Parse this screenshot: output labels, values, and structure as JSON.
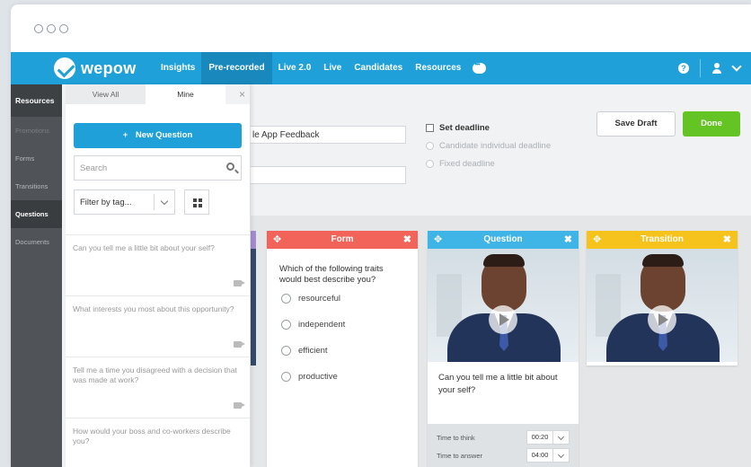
{
  "navbar": {
    "brand": "wepow",
    "items": [
      {
        "label": "Insights",
        "active": false
      },
      {
        "label": "Pre-recorded",
        "active": true
      },
      {
        "label": "Live 2.0",
        "active": false
      },
      {
        "label": "Live",
        "active": false
      },
      {
        "label": "Candidates",
        "active": false
      },
      {
        "label": "Resources",
        "active": false
      }
    ],
    "help": "?"
  },
  "sidebar": {
    "items": [
      "Resources",
      "Promotions",
      "Forms",
      "Transitions",
      "Questions",
      "Documents"
    ],
    "active": "Questions"
  },
  "panel": {
    "tabs": [
      "View All",
      "Mine"
    ],
    "active_tab": "Mine",
    "close": "×",
    "new_question": "New Question",
    "new_question_icon": "+",
    "search_placeholder": "Search",
    "filter_label": "Filter by tag...",
    "questions": [
      "Can you tell me a little bit about your self?",
      "What interests you most about this opportunity?",
      "Tell me a time you disagreed with a decision that was made at work?",
      "How would your boss and co-workers describe you?"
    ]
  },
  "form": {
    "title_value": "le App Feedback",
    "set_deadline": "Set deadline",
    "candidate_deadline": "Candidate individual deadline",
    "fixed_deadline": "Fixed deadline",
    "save_draft": "Save Draft",
    "done": "Done"
  },
  "cards": {
    "form_card": {
      "title": "Form",
      "question": "Which of the following traits would best describe you?",
      "options": [
        "resourceful",
        "independent",
        "efficient",
        "productive"
      ],
      "color": "#f2645a"
    },
    "question_card": {
      "title": "Question",
      "text": "Can you tell me a little bit about your self?",
      "color": "#3fb4e6",
      "time_to_think_label": "Time to think",
      "time_to_think": "00:20",
      "time_to_answer_label": "Time to answer",
      "time_to_answer": "04:00"
    },
    "transition_card": {
      "title": "Transition",
      "color": "#f6c31c"
    },
    "move_icon": "✥",
    "close_icon": "✖"
  }
}
